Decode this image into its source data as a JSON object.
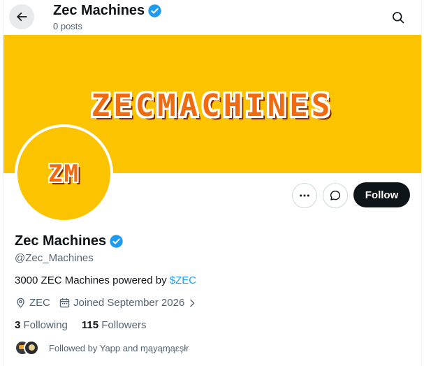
{
  "header": {
    "name": "Zec Machines",
    "posts": "0 posts"
  },
  "banner": {
    "text": "ZECMACHINES"
  },
  "avatar": {
    "text": "ZM"
  },
  "actions": {
    "follow_label": "Follow"
  },
  "profile": {
    "name": "Zec Machines",
    "handle": "@Zec_Machines",
    "bio_text": "3000 ZEC Machines powered by ",
    "bio_link": "$ZEC",
    "location": "ZEC",
    "joined": "Joined September 2026",
    "following_count": "3",
    "following_label": "Following",
    "followers_count": "115",
    "followers_label": "Followers",
    "followed_by": "Followed by Yapp and ɱąyąɱąεşłr"
  },
  "colors": {
    "banner_bg": "#fcc400",
    "verified_blue": "#1d9bf0",
    "follow_button_bg": "#0f1419",
    "secondary_text": "#536471"
  },
  "icons": [
    "back-arrow-icon",
    "search-icon",
    "verified-badge-icon",
    "more-icon",
    "message-icon",
    "location-icon",
    "calendar-icon",
    "chevron-right-icon"
  ]
}
